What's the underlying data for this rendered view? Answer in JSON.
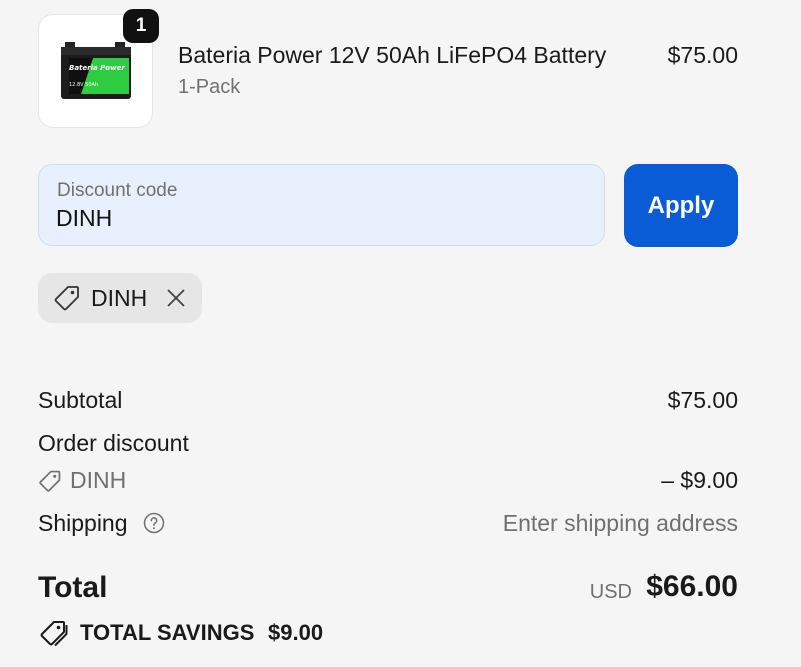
{
  "line_item": {
    "quantity": "1",
    "name": "Bateria Power 12V 50Ah LiFePO4 Battery",
    "variant": "1-Pack",
    "price": "$75.00",
    "image_brand_text": "Bateria Power",
    "image_spec_text": "12.8V 50Ah"
  },
  "discount": {
    "label": "Discount code",
    "value": "DINH",
    "apply_label": "Apply",
    "applied_code": "DINH"
  },
  "summary": {
    "subtotal_label": "Subtotal",
    "subtotal_value": "$75.00",
    "order_discount_label": "Order discount",
    "discount_code": "DINH",
    "discount_value": "– $9.00",
    "shipping_label": "Shipping",
    "shipping_value": "Enter shipping address",
    "total_label": "Total",
    "currency": "USD",
    "total_value": "$66.00",
    "savings_label": "TOTAL SAVINGS",
    "savings_value": "$9.00"
  },
  "colors": {
    "accent": "#0a5bd6",
    "field_background": "#e8f0fe",
    "battery_green": "#2ecc40"
  }
}
